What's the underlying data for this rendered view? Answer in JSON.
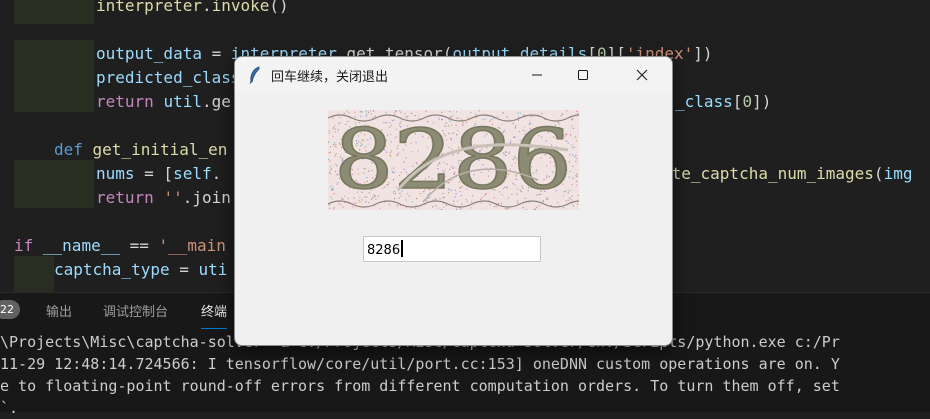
{
  "editor": {
    "lines": [
      {
        "parts": [
          [
            "fn",
            "interpreter.invoke"
          ],
          [
            "",
            "()"
          ]
        ]
      },
      {
        "parts": []
      },
      {
        "parts": [
          [
            "var",
            "output_data"
          ],
          [
            "",
            " = "
          ],
          [
            "var",
            "interpreter"
          ],
          [
            "",
            ".get_tensor("
          ],
          [
            "var",
            "output_details"
          ],
          [
            "",
            "["
          ],
          [
            "num",
            "0"
          ],
          [
            "",
            "]["
          ],
          [
            "str",
            "'index'"
          ],
          [
            "",
            "])"
          ]
        ]
      },
      {
        "parts": [
          [
            "var",
            "predicted_class"
          ]
        ]
      },
      {
        "parts": [
          [
            "ctrl",
            "return "
          ],
          [
            "var",
            "util"
          ],
          [
            "",
            ".ge"
          ]
        ]
      },
      {
        "parts": []
      },
      {
        "parts": [
          [
            "kw",
            "def "
          ],
          [
            "fn",
            "get_initial_en"
          ]
        ]
      },
      {
        "parts": [
          [
            "var",
            "nums"
          ],
          [
            "",
            " = ["
          ],
          [
            "var",
            "self"
          ],
          [
            "",
            "."
          ]
        ]
      },
      {
        "parts": [
          [
            "ctrl",
            "return "
          ],
          [
            "str",
            "''"
          ],
          [
            "",
            ".join"
          ]
        ]
      },
      {
        "parts": []
      },
      {
        "parts": [
          [
            "ctrl",
            "if "
          ],
          [
            "var",
            "__name__"
          ],
          [
            "",
            " == "
          ],
          [
            "str",
            "'__main"
          ]
        ]
      },
      {
        "parts": [
          [
            "var",
            "captcha_type"
          ],
          [
            "",
            " = "
          ],
          [
            "var",
            "uti"
          ]
        ]
      }
    ],
    "right_fragments": [
      {
        "row": 4,
        "parts": [
          [
            "var",
            "_class"
          ],
          [
            "",
            "["
          ],
          [
            "num",
            "0"
          ],
          [
            "",
            "])"
          ]
        ]
      },
      {
        "row": 7,
        "parts": [
          [
            "fn",
            "ate_captcha_num_images"
          ],
          [
            "",
            "("
          ],
          [
            "var",
            "img"
          ]
        ]
      }
    ]
  },
  "panel": {
    "badge": "22",
    "tabs": [
      "输出",
      "调试控制台",
      "终端"
    ],
    "active_tab": "终端",
    "terminal_lines": [
      "\\Projects\\Misc\\captcha-solver> & c:/Projects/Misc/captcha-solver/env/Scripts/python.exe c:/Pr",
      "11-29 12:48:14.724566: I tensorflow/core/util/port.cc:153] oneDNN custom operations are on. Y",
      "e to floating-point round-off errors from different computation orders. To turn them off, set",
      "`."
    ]
  },
  "dialog": {
    "title": "回车继续，关闭退出",
    "captcha_text": "8286",
    "entry_value": "8286"
  },
  "colors": {
    "editor_bg": "#1f1f1f",
    "dialog_bg": "#f0f0f0",
    "captcha_bg": "#f1e3e1",
    "captcha_digits": "#8c8c74",
    "accent": "#0078d4"
  }
}
